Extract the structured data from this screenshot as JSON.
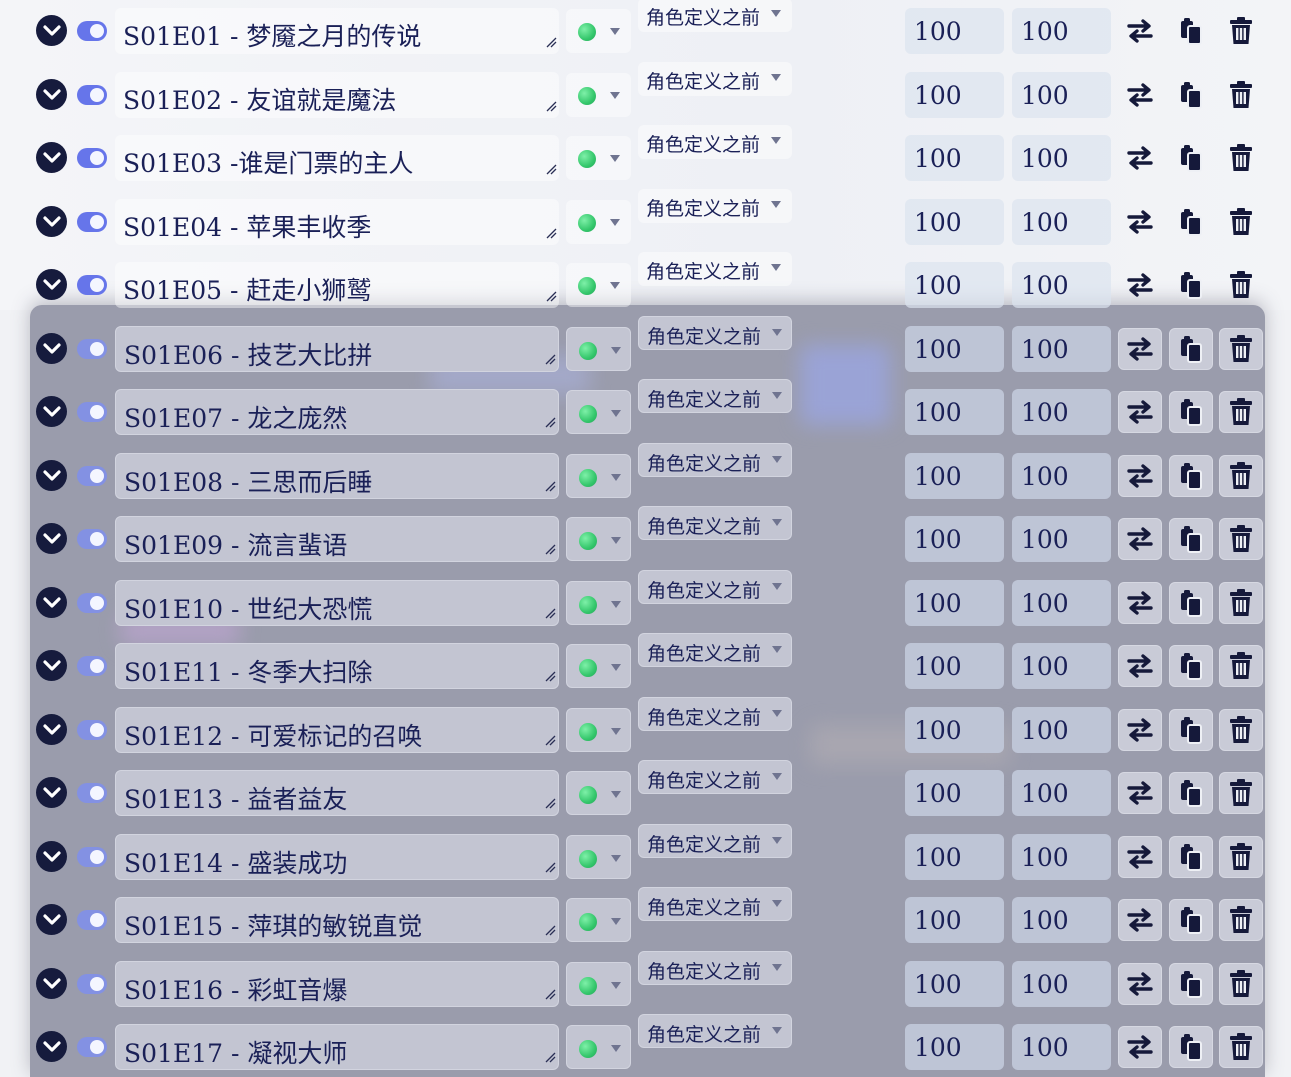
{
  "colors": {
    "toggle_on": "#6675ea",
    "status_dot": "#35c76c",
    "text": "#1a2057",
    "chevron_bg": "#161b3d"
  },
  "icons": {
    "expand": "chevron-down-icon",
    "enabled": "toggle-switch-icon",
    "status": "green-dot-icon",
    "swap": "swap-arrows-icon",
    "copy": "copy-icon",
    "delete": "trash-icon"
  },
  "rows": [
    {
      "name": "S01E01 - 梦魇之月的传说",
      "role": "角色定义之前",
      "value1": "100",
      "value2": "100",
      "enabled": true,
      "status": "green"
    },
    {
      "name": "S01E02 - 友谊就是魔法",
      "role": "角色定义之前",
      "value1": "100",
      "value2": "100",
      "enabled": true,
      "status": "green"
    },
    {
      "name": "S01E03 -谁是门票的主人",
      "role": "角色定义之前",
      "value1": "100",
      "value2": "100",
      "enabled": true,
      "status": "green"
    },
    {
      "name": "S01E04 - 苹果丰收季",
      "role": "角色定义之前",
      "value1": "100",
      "value2": "100",
      "enabled": true,
      "status": "green"
    },
    {
      "name": "S01E05 - 赶走小狮鹫",
      "role": "角色定义之前",
      "value1": "100",
      "value2": "100",
      "enabled": true,
      "status": "green"
    },
    {
      "name": "S01E06 - 技艺大比拼",
      "role": "角色定义之前",
      "value1": "100",
      "value2": "100",
      "enabled": true,
      "status": "green"
    },
    {
      "name": "S01E07 - 龙之庞然",
      "role": "角色定义之前",
      "value1": "100",
      "value2": "100",
      "enabled": true,
      "status": "green"
    },
    {
      "name": "S01E08 - 三思而后睡",
      "role": "角色定义之前",
      "value1": "100",
      "value2": "100",
      "enabled": true,
      "status": "green"
    },
    {
      "name": "S01E09 - 流言蜚语",
      "role": "角色定义之前",
      "value1": "100",
      "value2": "100",
      "enabled": true,
      "status": "green"
    },
    {
      "name": "S01E10 - 世纪大恐慌",
      "role": "角色定义之前",
      "value1": "100",
      "value2": "100",
      "enabled": true,
      "status": "green"
    },
    {
      "name": "S01E11 - 冬季大扫除",
      "role": "角色定义之前",
      "value1": "100",
      "value2": "100",
      "enabled": true,
      "status": "green"
    },
    {
      "name": "S01E12 - 可爱标记的召唤",
      "role": "角色定义之前",
      "value1": "100",
      "value2": "100",
      "enabled": true,
      "status": "green"
    },
    {
      "name": "S01E13 - 益者益友",
      "role": "角色定义之前",
      "value1": "100",
      "value2": "100",
      "enabled": true,
      "status": "green"
    },
    {
      "name": "S01E14 - 盛装成功",
      "role": "角色定义之前",
      "value1": "100",
      "value2": "100",
      "enabled": true,
      "status": "green"
    },
    {
      "name": "S01E15 - 萍琪的敏锐直觉",
      "role": "角色定义之前",
      "value1": "100",
      "value2": "100",
      "enabled": true,
      "status": "green"
    },
    {
      "name": "S01E16 - 彩虹音爆",
      "role": "角色定义之前",
      "value1": "100",
      "value2": "100",
      "enabled": true,
      "status": "green"
    },
    {
      "name": "S01E17 - 凝视大师",
      "role": "角色定义之前",
      "value1": "100",
      "value2": "100",
      "enabled": true,
      "status": "green"
    }
  ]
}
